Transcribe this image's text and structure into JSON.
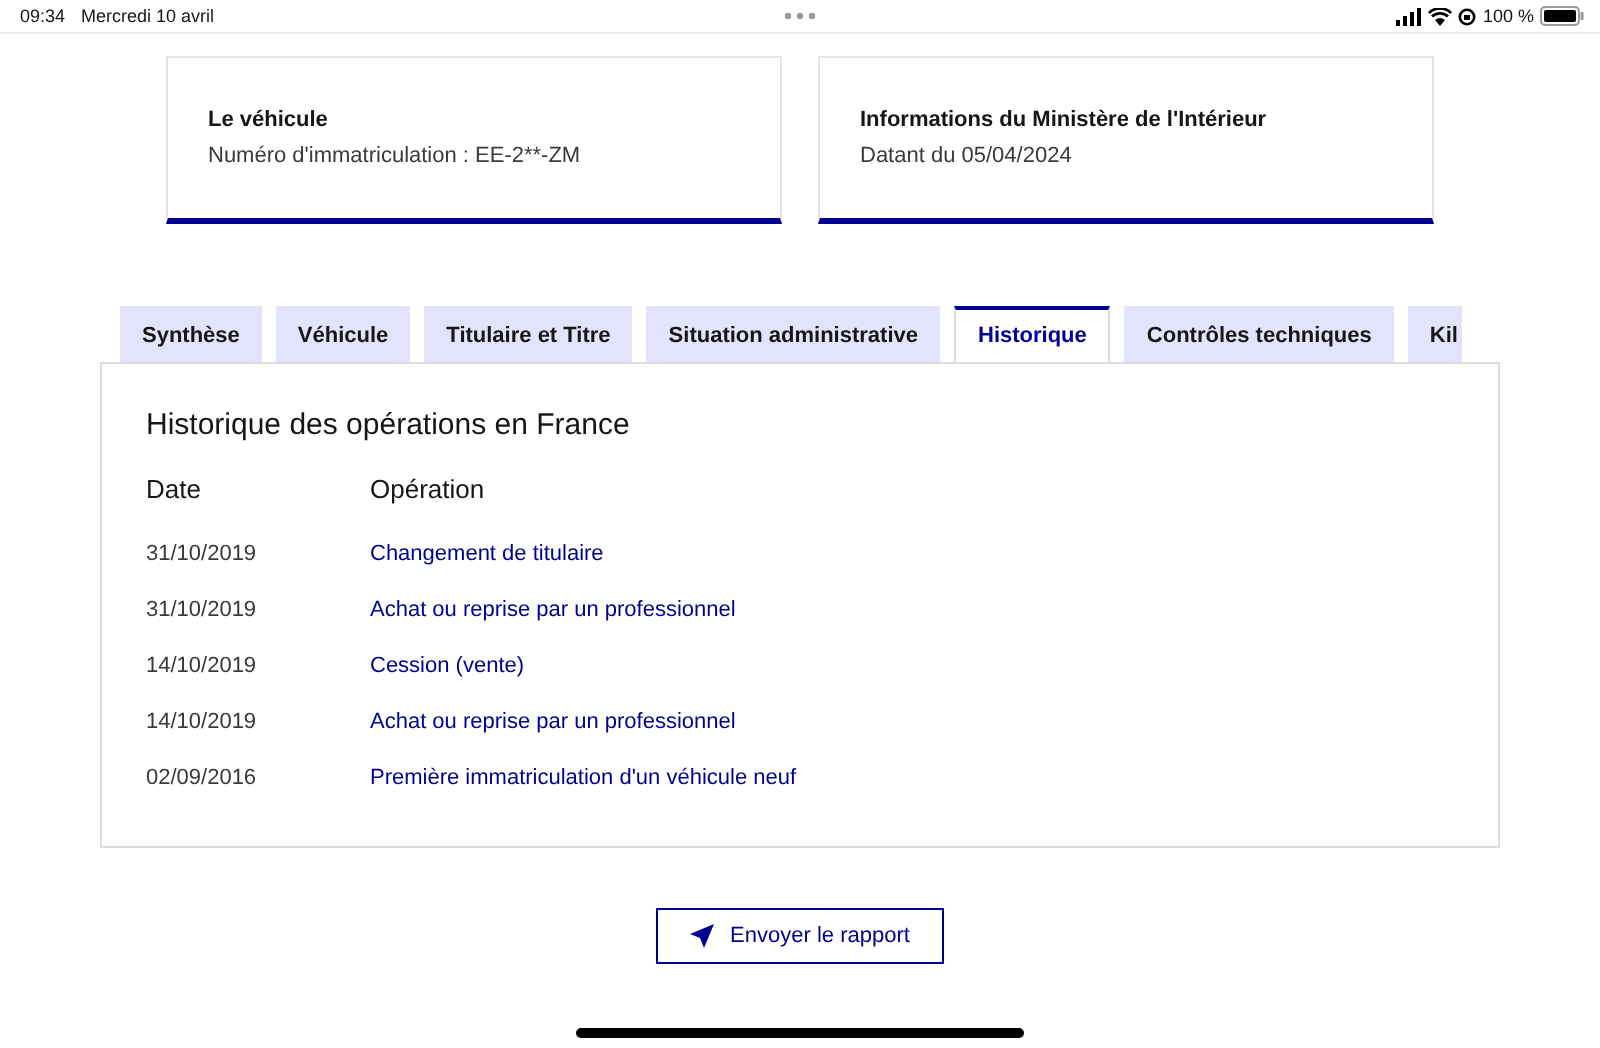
{
  "status_bar": {
    "time": "09:34",
    "date": "Mercredi 10 avril",
    "battery": "100 %"
  },
  "cards": [
    {
      "title": "Le véhicule",
      "text": "Numéro d'immatriculation : EE-2**-ZM"
    },
    {
      "title": "Informations du Ministère de l'Intérieur",
      "text": "Datant du 05/04/2024"
    }
  ],
  "tabs": [
    {
      "label": "Synthèse",
      "selected": false
    },
    {
      "label": "Véhicule",
      "selected": false
    },
    {
      "label": "Titulaire et Titre",
      "selected": false
    },
    {
      "label": "Situation administrative",
      "selected": false
    },
    {
      "label": "Historique",
      "selected": true
    },
    {
      "label": "Contrôles techniques",
      "selected": false
    },
    {
      "label": "Kil",
      "selected": false
    }
  ],
  "panel": {
    "title": "Historique des opérations en France",
    "columns": [
      "Date",
      "Opération"
    ],
    "rows": [
      {
        "date": "31/10/2019",
        "operation": "Changement de titulaire"
      },
      {
        "date": "31/10/2019",
        "operation": "Achat ou reprise par un professionnel"
      },
      {
        "date": "14/10/2019",
        "operation": "Cession (vente)"
      },
      {
        "date": "14/10/2019",
        "operation": "Achat ou reprise par un professionnel"
      },
      {
        "date": "02/09/2016",
        "operation": "Première immatriculation d'un véhicule neuf"
      }
    ]
  },
  "button": "Envoyer le rapport"
}
